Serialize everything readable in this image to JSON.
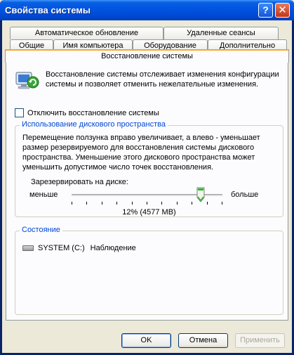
{
  "window": {
    "title": "Свойства системы",
    "help_symbol": "?",
    "close_symbol": "✕"
  },
  "tabs": {
    "row1": [
      {
        "label": "Автоматическое обновление"
      },
      {
        "label": "Удаленные сеансы"
      }
    ],
    "row2": [
      {
        "label": "Общие"
      },
      {
        "label": "Имя компьютера"
      },
      {
        "label": "Оборудование"
      },
      {
        "label": "Дополнительно"
      }
    ],
    "active": {
      "label": "Восстановление системы"
    }
  },
  "content": {
    "description": "Восстановление системы отслеживает изменения конфигурации системы и позволяет отменить нежелательные изменения.",
    "disable_checkbox": {
      "label": "Отключить восстановление системы",
      "checked": false
    },
    "disk_group": {
      "title": "Использование дискового пространства",
      "description": "Перемещение ползунка вправо увеличивает, а влево - уменьшает размер резервируемого для восстановления системы дискового пространства. Уменьшение этого дискового пространства может уменьшить допустимое число точек восстановления.",
      "reserve_label": "Зарезервировать на диске:",
      "less_label": "меньше",
      "more_label": "больше",
      "slider_percent": 12,
      "percent_text": "12% (4577 MB)"
    },
    "status_group": {
      "title": "Состояние",
      "drive": {
        "name": "SYSTEM (C:)",
        "status": "Наблюдение",
        "icon": "drive-icon"
      }
    }
  },
  "buttons": {
    "ok": "OK",
    "cancel": "Отмена",
    "apply": "Применить"
  }
}
